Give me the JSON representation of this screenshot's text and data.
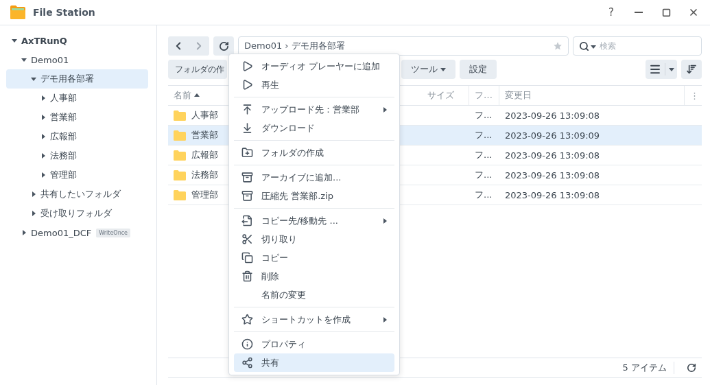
{
  "window": {
    "title": "File Station",
    "controls": [
      "?"
    ]
  },
  "tree": [
    {
      "label": "AxTRunQ",
      "expanded": true,
      "selected": false,
      "children": [
        {
          "label": "Demo01",
          "expanded": true,
          "selected": false,
          "children": [
            {
              "label": "デモ用各部署",
              "expanded": true,
              "selected": true,
              "children": [
                {
                  "label": "人事部",
                  "expanded": false,
                  "selected": false
                },
                {
                  "label": "営業部",
                  "expanded": false,
                  "selected": false
                },
                {
                  "label": "広報部",
                  "expanded": false,
                  "selected": false
                },
                {
                  "label": "法務部",
                  "expanded": false,
                  "selected": false
                },
                {
                  "label": "管理部",
                  "expanded": false,
                  "selected": false
                }
              ]
            },
            {
              "label": "共有したいフォルダ",
              "expanded": false,
              "selected": false
            },
            {
              "label": "受け取りフォルダ",
              "expanded": false,
              "selected": false
            }
          ]
        },
        {
          "label": "Demo01_DCF",
          "expanded": false,
          "selected": false,
          "badge": "WriteOnce"
        }
      ]
    }
  ],
  "path": "Demo01 › デモ用各部署",
  "search": {
    "placeholder": "検索"
  },
  "toolbar": {
    "left_button": "フォルダの作",
    "tools_button": "ツール",
    "settings_button": "設定"
  },
  "table": {
    "columns": [
      "名前",
      "サイズ",
      "フ…",
      "変更日"
    ],
    "column_menu": "⋮",
    "rows": [
      {
        "name": "人事部",
        "type": "フ...",
        "modified": "2023-09-26 13:09:08",
        "selected": false
      },
      {
        "name": "営業部",
        "type": "フ...",
        "modified": "2023-09-26 13:09:09",
        "selected": true
      },
      {
        "name": "広報部",
        "type": "フ...",
        "modified": "2023-09-26 13:09:08",
        "selected": false
      },
      {
        "name": "法務部",
        "type": "フ...",
        "modified": "2023-09-26 13:09:08",
        "selected": false
      },
      {
        "name": "管理部",
        "type": "フ...",
        "modified": "2023-09-26 13:09:08",
        "selected": false
      }
    ]
  },
  "status_bar": {
    "count": "5 アイテム"
  },
  "context_menu": [
    {
      "kind": "item",
      "label": "オーディオ プレーヤーに追加",
      "submenu": false,
      "selected": false
    },
    {
      "kind": "item",
      "label": "再生",
      "submenu": false,
      "selected": false
    },
    {
      "kind": "separator"
    },
    {
      "kind": "item",
      "label": "アップロード先：営業部",
      "submenu": true,
      "selected": false
    },
    {
      "kind": "item",
      "label": "ダウンロード",
      "submenu": false,
      "selected": false
    },
    {
      "kind": "separator"
    },
    {
      "kind": "item",
      "label": "フォルダの作成",
      "submenu": false,
      "selected": false
    },
    {
      "kind": "separator"
    },
    {
      "kind": "item",
      "label": "アーカイブに追加...",
      "submenu": false,
      "selected": false
    },
    {
      "kind": "item",
      "label": "圧縮先 営業部.zip",
      "submenu": false,
      "selected": false
    },
    {
      "kind": "separator"
    },
    {
      "kind": "item",
      "label": "コピー先/移動先 ...",
      "submenu": true,
      "selected": false
    },
    {
      "kind": "item",
      "label": "切り取り",
      "submenu": false,
      "selected": false
    },
    {
      "kind": "item",
      "label": "コピー",
      "submenu": false,
      "selected": false
    },
    {
      "kind": "item",
      "label": "削除",
      "submenu": false,
      "selected": false
    },
    {
      "kind": "item",
      "label": "名前の変更",
      "submenu": false,
      "selected": false
    },
    {
      "kind": "separator"
    },
    {
      "kind": "item",
      "label": "ショートカットを作成",
      "submenu": true,
      "selected": false
    },
    {
      "kind": "separator"
    },
    {
      "kind": "item",
      "label": "プロパティ",
      "submenu": false,
      "selected": false
    },
    {
      "kind": "item",
      "label": "共有",
      "submenu": false,
      "selected": true
    }
  ]
}
